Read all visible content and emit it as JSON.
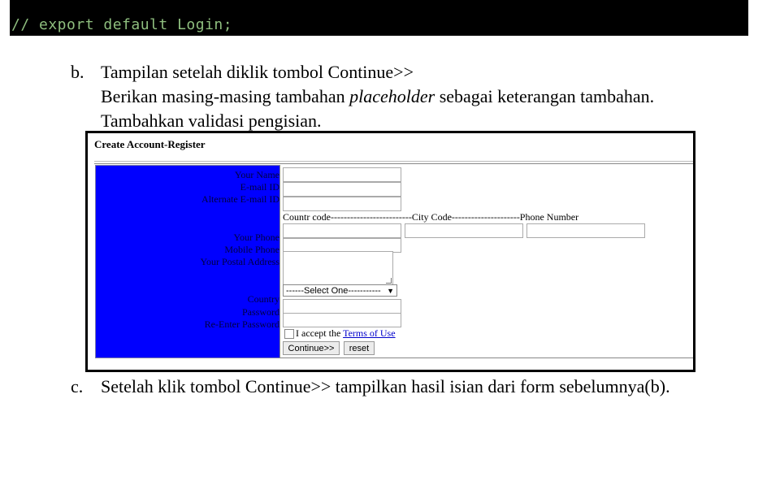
{
  "code": {
    "line": "// export default Login;"
  },
  "doc": {
    "b_marker": "b.",
    "b_line1": "Tampilan setelah diklik tombol Continue>>",
    "b_line2_pre": "Berikan masing-masing tambahan ",
    "b_line2_em": "placeholder",
    "b_line2_post": " sebagai keterangan tambahan.",
    "b_line3": "Tambahkan validasi pengisian.",
    "c_marker": "c.",
    "c_line": "Setelah klik tombol Continue>>  tampilkan hasil isian dari form sebelumnya(b)."
  },
  "form": {
    "title": "Create Account-Register",
    "labels": {
      "name": "Your Name",
      "email": "E-mail ID",
      "alt_email": "Alternate E-mail ID",
      "phone": "Your Phone",
      "mobile": "Mobile Phone",
      "postal": "Your Postal Address",
      "country": "Country",
      "password": "Password",
      "repassword": "Re-Enter Password"
    },
    "phone_header": "Countr code-------------------------City Code---------------------Phone Number",
    "country_select": "------Select One-----------",
    "accept_text": "I accept the ",
    "terms_link": "Terms of Use",
    "continue_button": "Continue>>",
    "reset_button": "reset"
  },
  "colors": {
    "label_panel": "#0000ff",
    "code_bg": "#000000",
    "code_text": "#8fbf7f"
  }
}
